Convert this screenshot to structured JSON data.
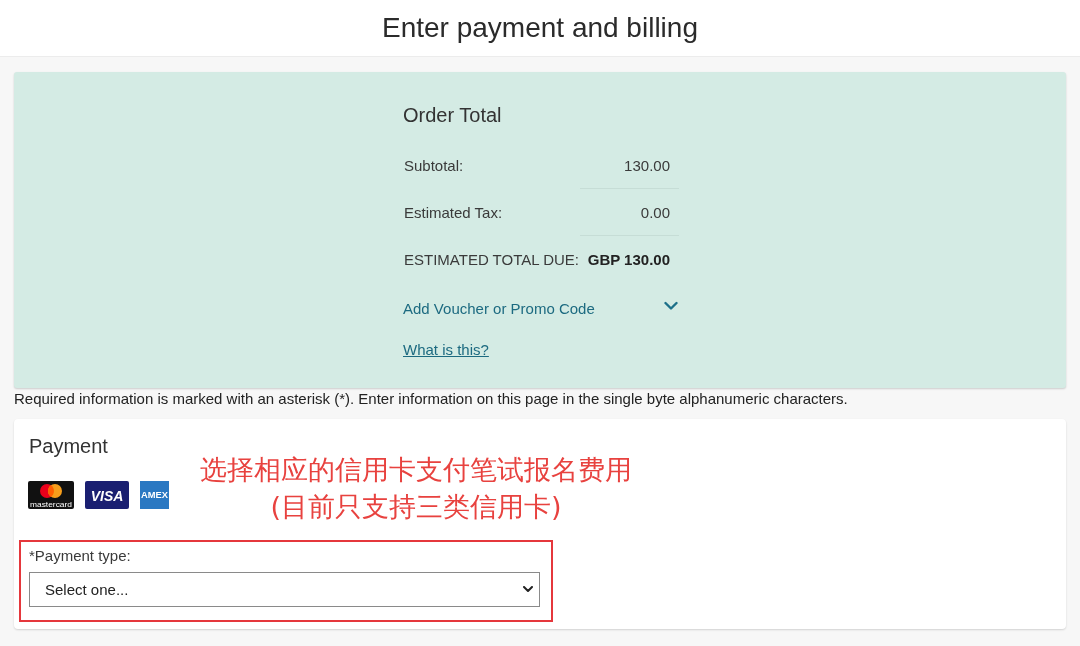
{
  "header": {
    "title": "Enter payment and billing"
  },
  "order_total": {
    "title": "Order Total",
    "rows": [
      {
        "kind": "line",
        "label": "Subtotal:",
        "value": "130.00"
      },
      {
        "kind": "line",
        "label": "Estimated Tax:",
        "value": "0.00"
      },
      {
        "kind": "total",
        "label": "ESTIMATED TOTAL DUE:",
        "value": "GBP 130.00"
      }
    ],
    "voucher": {
      "label": "Add Voucher or Promo Code",
      "expanded": false
    },
    "help_link": "What is this?"
  },
  "notice": "Required information is marked with an asterisk (*). Enter information on this page in the single byte alphanumeric characters.",
  "payment": {
    "title": "Payment",
    "card_logos": [
      {
        "kind": "mastercard",
        "label": "mastercard"
      },
      {
        "kind": "visa",
        "label": "VISA"
      },
      {
        "kind": "amex",
        "label": "AMEX"
      }
    ],
    "payment_type": {
      "label": "*Payment type:",
      "value": "Select one..."
    }
  },
  "annotation": {
    "lines": [
      "选择相应的信用卡支付笔试报名费用",
      "(目前只支持三类信用卡)"
    ]
  }
}
